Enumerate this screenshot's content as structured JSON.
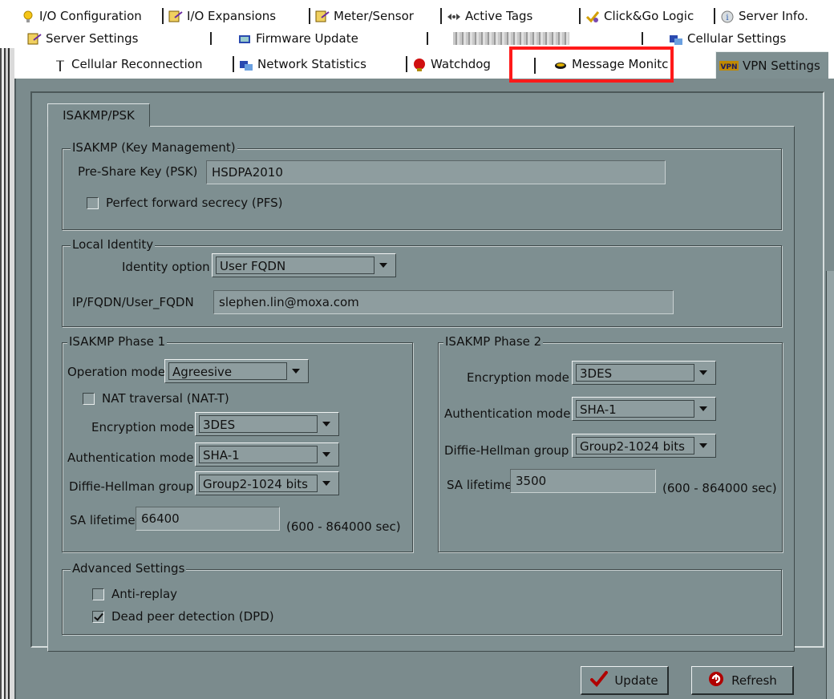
{
  "tabs_row1": [
    {
      "label": "I/O Configuration",
      "icon": "lightbulb-icon"
    },
    {
      "label": "I/O Expansions",
      "icon": "io-module-icon"
    },
    {
      "label": "Meter/Sensor",
      "icon": "meter-icon"
    },
    {
      "label": "Active Tags",
      "icon": "active-tags-icon"
    },
    {
      "label": "Click&Go Logic",
      "icon": "logic-icon"
    },
    {
      "label": "Server Info.",
      "icon": "info-icon"
    }
  ],
  "tabs_row2": [
    {
      "label": "Server Settings",
      "icon": "server-settings-icon"
    },
    {
      "label": "Firmware Update",
      "icon": "firmware-icon"
    },
    {
      "label": "Cellular Settings",
      "icon": "cellular-settings-icon"
    }
  ],
  "tabs_row3": [
    {
      "label": "Cellular Reconnection",
      "icon": "antenna-icon"
    },
    {
      "label": "Network Statistics",
      "icon": "network-icon"
    },
    {
      "label": "Watchdog",
      "icon": "watchdog-icon"
    },
    {
      "label": "Message Monitc",
      "icon": "message-icon"
    },
    {
      "label": "VPN Settings",
      "icon": "vpn-icon"
    }
  ],
  "subtab": "ISAKMP/PSK",
  "isakmp": {
    "legend": "ISAKMP (Key Management)",
    "psk_label": "Pre-Share Key (PSK)",
    "psk_value": "HSDPA2010",
    "pfs_label": "Perfect forward secrecy (PFS)",
    "pfs_checked": false
  },
  "local_identity": {
    "legend": "Local Identity",
    "identity_label": "Identity option",
    "identity_value": "User FQDN",
    "ip_label": "IP/FQDN/User_FQDN",
    "ip_value": "slephen.lin@moxa.com"
  },
  "phase1": {
    "legend": "ISAKMP Phase 1",
    "operation_label": "Operation mode",
    "operation_value": "Agreesive",
    "nat_label": "NAT traversal (NAT-T)",
    "nat_checked": false,
    "encryption_label": "Encryption mode",
    "encryption_value": "3DES",
    "auth_label": "Authentication mode",
    "auth_value": "SHA-1",
    "dh_label": "Diffie-Hellman group",
    "dh_value": "Group2-1024 bits",
    "sa_label": "SA lifetime",
    "sa_value": "66400",
    "sa_range": "(600 - 864000 sec)"
  },
  "phase2": {
    "legend": "ISAKMP Phase 2",
    "encryption_label": "Encryption mode",
    "encryption_value": "3DES",
    "auth_label": "Authentication mode",
    "auth_value": "SHA-1",
    "dh_label": "Diffie-Hellman group",
    "dh_value": "Group2-1024 bits",
    "sa_label": "SA lifetime",
    "sa_value": "3500",
    "sa_range": "(600 - 864000 sec)"
  },
  "advanced": {
    "legend": "Advanced Settings",
    "antireplay_label": "Anti-replay",
    "antireplay_checked": false,
    "dpd_label": "Dead peer detection (DPD)",
    "dpd_checked": true
  },
  "buttons": {
    "update": "Update",
    "refresh": "Refresh"
  },
  "colors": {
    "panel": "#7e8f91",
    "highlight": "#ff1a1a",
    "check": "#1a8a1a",
    "refresh": "#c22"
  }
}
